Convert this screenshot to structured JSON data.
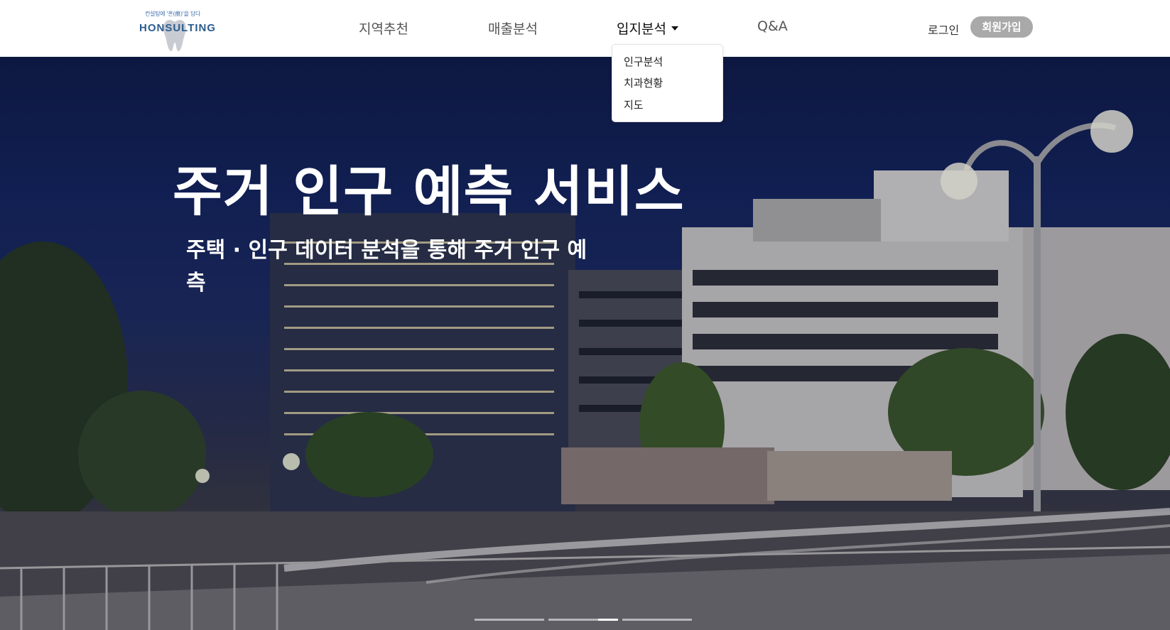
{
  "header": {
    "logo": {
      "tagline": "컨설팅에 '흔(痕)'을 담다",
      "name": "HONSULTING"
    },
    "nav": [
      {
        "label": "지역추천"
      },
      {
        "label": "매출분석"
      },
      {
        "label": "입지분석"
      },
      {
        "label": "Q&A"
      }
    ],
    "login_label": "로그인",
    "signup_label": "회원가입"
  },
  "dropdown": {
    "items": [
      {
        "label": "인구분석"
      },
      {
        "label": "치과현황"
      },
      {
        "label": "지도"
      }
    ]
  },
  "hero": {
    "title": "주거 인구 예측 서비스",
    "subtitle": "주택 · 인구 데이터 분석을 통해 주거 인구 예측",
    "slides": {
      "total": 3,
      "active": 2
    }
  },
  "colors": {
    "signup_bg": "#a9a9a9",
    "logo_blue": "#2b5c8f",
    "hero_sky": "#13235a"
  }
}
